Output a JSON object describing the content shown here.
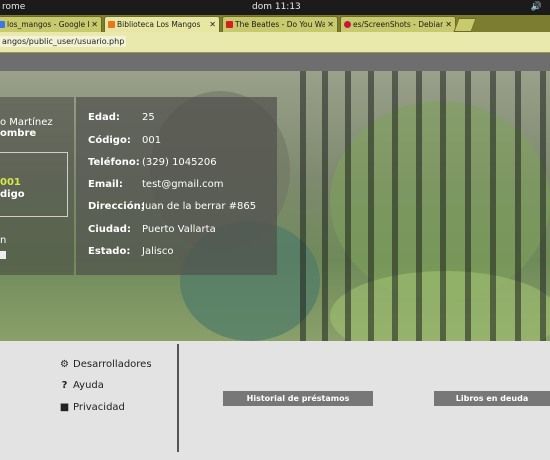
{
  "topbar": {
    "app": "rome",
    "clock": "dom 11:13",
    "volume_icon": "speaker-icon"
  },
  "tabs": [
    {
      "title": "los_mangos - Google Dri",
      "favicon_color": "#3b78e7",
      "active": false
    },
    {
      "title": "Biblioteca Los Mangos",
      "favicon_color": "#e8761c",
      "active": true
    },
    {
      "title": "The Beatles - Do You Wa",
      "favicon_color": "#d42020",
      "active": false
    },
    {
      "title": "es/ScreenShots - Debian",
      "favicon_color": "#c7163e",
      "active": false
    }
  ],
  "address": {
    "url": "angos/public_user/usuario.php"
  },
  "profile": {
    "name_line1": "o Martínez",
    "name_line2": "ombre",
    "code_value": "001",
    "code_label": "digo",
    "extra": "n"
  },
  "info": {
    "rows": [
      {
        "label": "Edad:",
        "value": "25"
      },
      {
        "label": "Código:",
        "value": "001"
      },
      {
        "label": "Teléfono:",
        "value": "(329) 1045206"
      },
      {
        "label": "Email:",
        "value": "test@gmail.com"
      },
      {
        "label": "Dirección:",
        "value": "Juan de la berrar #865"
      },
      {
        "label": "Ciudad:",
        "value": "Puerto Vallarta"
      },
      {
        "label": "Estado:",
        "value": "Jalisco"
      }
    ]
  },
  "footer": {
    "links": [
      {
        "icon": "wrench-icon",
        "label": "Desarrolladores"
      },
      {
        "icon": "question-icon",
        "label": "Ayuda"
      },
      {
        "icon": "lock-icon",
        "label": "Privacidad"
      }
    ],
    "buttons": {
      "history": "Historial de préstamos",
      "debt": "Libros en deuda"
    }
  }
}
